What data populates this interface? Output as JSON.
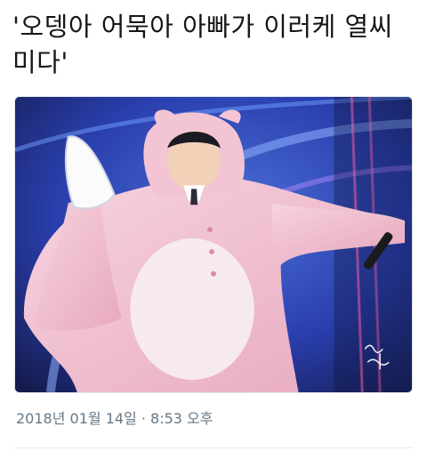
{
  "tweet": {
    "text": "'오뎅아 어묵아 아빠가 이러케 열씨미다'",
    "timestamp": "2018년 01월 14일 · 8:53 오후"
  },
  "media": {
    "photo_icon": "concert-photo",
    "watermark_icon": "handwritten-watermark"
  },
  "colors": {
    "text": "#14171a",
    "meta": "#657786",
    "divider": "#e6ecf0",
    "costume_pink": "#f2c4d3",
    "stage_blue": "#2a3fae"
  }
}
